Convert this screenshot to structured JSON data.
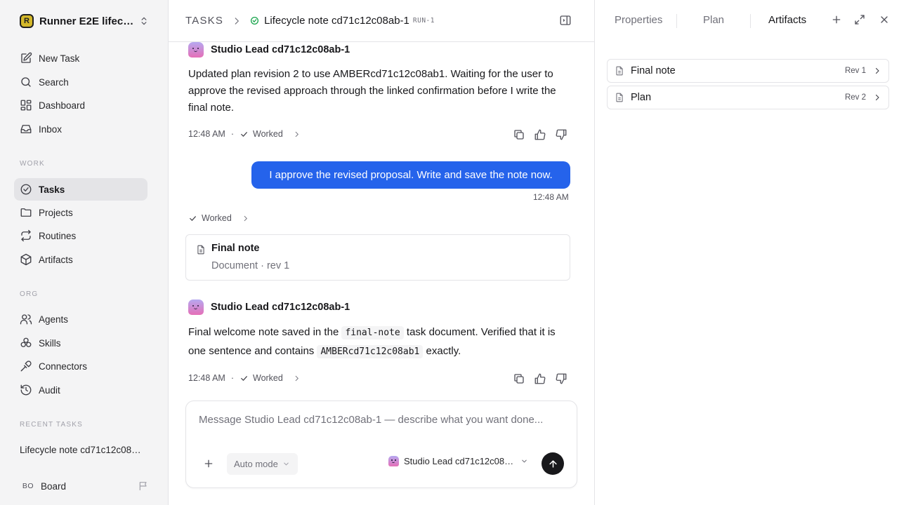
{
  "workspace": {
    "name": "Runner E2E lifecycle",
    "logo_letter": "R"
  },
  "nav": {
    "new_task": "New Task",
    "search": "Search",
    "dashboard": "Dashboard",
    "inbox": "Inbox",
    "work_label": "WORK",
    "tasks": "Tasks",
    "projects": "Projects",
    "routines": "Routines",
    "artifacts": "Artifacts",
    "org_label": "ORG",
    "agents": "Agents",
    "skills": "Skills",
    "connectors": "Connectors",
    "audit": "Audit",
    "recent_label": "RECENT TASKS",
    "recent_task": "Lifecycle note cd71c12c08ab-1"
  },
  "user": {
    "initials": "BO",
    "name": "Board"
  },
  "breadcrumb": {
    "root": "TASKS",
    "title": "Lifecycle note cd71c12c08ab-1",
    "run": "RUN-1"
  },
  "feed": {
    "message1": {
      "author": "Studio Lead cd71c12c08ab-1",
      "text": "Updated plan revision 2 to use AMBERcd71c12c08ab1. Waiting for the user to approve the revised approach through the linked confirmation before I write the final note.",
      "time": "12:48 AM",
      "status": "Worked"
    },
    "user_message": {
      "text": "I approve the revised proposal. Write and save the note now.",
      "time": "12:48 AM"
    },
    "worked_status": "Worked",
    "doc_card": {
      "title": "Final note",
      "subtitle": "Document · rev 1"
    },
    "message2": {
      "author": "Studio Lead cd71c12c08ab-1",
      "text_a": "Final welcome note saved in the ",
      "code_a": "final-note",
      "text_b": " task document. Verified that it is one sentence and contains ",
      "code_b": "AMBERcd71c12c08ab1",
      "text_c": " exactly.",
      "time": "12:48 AM",
      "status": "Worked"
    }
  },
  "composer": {
    "placeholder": "Message Studio Lead cd71c12c08ab-1 — describe what you want done...",
    "mode": "Auto mode",
    "agent": "Studio Lead cd71c12c08ab-1"
  },
  "right_panel": {
    "tabs": [
      "Properties",
      "Plan",
      "Artifacts"
    ],
    "active_tab": "Artifacts",
    "artifacts": [
      {
        "name": "Final note",
        "rev": "Rev 1"
      },
      {
        "name": "Plan",
        "rev": "Rev 2"
      }
    ]
  },
  "colors": {
    "accent": "#2563eb",
    "success": "#16a34a",
    "sidebar_bg": "#f4f4f5"
  }
}
